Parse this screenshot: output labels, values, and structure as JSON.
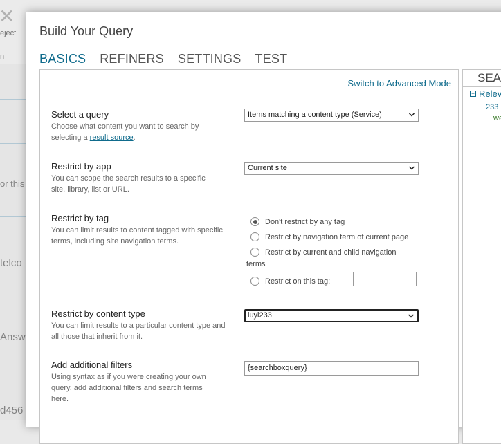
{
  "background": {
    "reject_label": "eject",
    "ribbon_small": "n",
    "snippet_1": "or this",
    "snippet_2": "telco",
    "snippet_3": "Answ",
    "snippet_4": "d456"
  },
  "dialog": {
    "title": "Build Your Query",
    "tabs": [
      {
        "label": "BASICS",
        "active": true
      },
      {
        "label": "REFINERS",
        "active": false
      },
      {
        "label": "SETTINGS",
        "active": false
      },
      {
        "label": "TEST",
        "active": false
      }
    ],
    "advanced_link": "Switch to Advanced Mode",
    "select_query": {
      "label": "Select a query",
      "help_prefix": "Choose what content you want to search by selecting a ",
      "help_link": "result source",
      "help_suffix": ".",
      "value": "Items matching a content type (Service)"
    },
    "restrict_app": {
      "label": "Restrict by app",
      "help": "You can scope the search results to a specific site, library, list or URL.",
      "value": "Current site"
    },
    "restrict_tag": {
      "label": "Restrict by tag",
      "help": "You can limit results to content tagged with specific terms, including site navigation terms.",
      "options": [
        {
          "label": "Don't restrict by any tag",
          "checked": true
        },
        {
          "label": "Restrict by navigation term of current page",
          "checked": false
        },
        {
          "label": "Restrict by current and child navigation",
          "label_cont": "terms",
          "checked": false
        },
        {
          "label": "Restrict on this tag:",
          "checked": false
        }
      ],
      "tag_value": ""
    },
    "restrict_content_type": {
      "label": "Restrict by content type",
      "help": "You can limit results to a particular content type and all those that inherit from it.",
      "value": "luyi233"
    },
    "additional_filters": {
      "label": "Add additional filters",
      "help": "Using syntax as if you were creating your own query, add additional filters and search terms here.",
      "value": "{searchboxquery}"
    }
  },
  "preview": {
    "title": "SEAR",
    "relevant": "Relev",
    "count": "233",
    "snippet": "we"
  },
  "colors": {
    "accent": "#0f6b8c",
    "text": "#222222",
    "help_text": "#666666"
  }
}
